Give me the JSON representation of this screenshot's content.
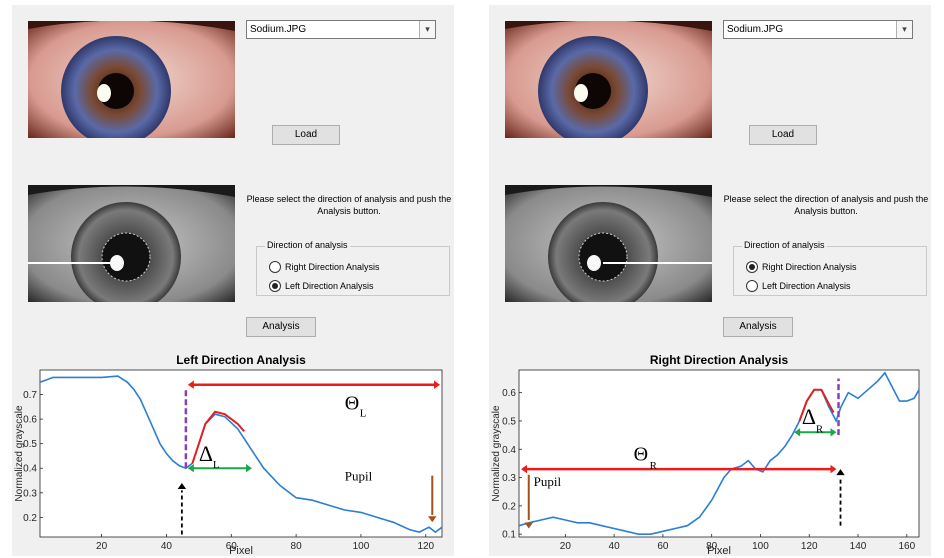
{
  "panels": [
    {
      "file_select": {
        "value": "Sodium.JPG",
        "arrow": "chevron-down-icon"
      },
      "load_button": "Load",
      "instruction": "Please select the direction of analysis and push the Analysis button.",
      "group": {
        "title": "Direction of analysis",
        "options": [
          {
            "label": "Right Direction Analysis",
            "selected": false
          },
          {
            "label": "Left Direction Analysis",
            "selected": true
          }
        ]
      },
      "analysis_button": "Analysis",
      "annotations": {
        "theta": "Θ",
        "theta_sub": "L",
        "delta": "Δ",
        "delta_sub": "L",
        "pupil": "Pupil"
      }
    },
    {
      "file_select": {
        "value": "Sodium.JPG",
        "arrow": "chevron-down-icon"
      },
      "load_button": "Load",
      "instruction": "Please select the direction of analysis and push the Analysis button.",
      "group": {
        "title": "Direction of analysis",
        "options": [
          {
            "label": "Right Direction Analysis",
            "selected": true
          },
          {
            "label": "Left Direction Analysis",
            "selected": false
          }
        ]
      },
      "analysis_button": "Analysis",
      "annotations": {
        "theta": "Θ",
        "theta_sub": "R",
        "delta": "Δ",
        "delta_sub": "R",
        "pupil": "Pupil"
      }
    }
  ],
  "chart_data": [
    {
      "type": "line",
      "title": "Left Direction Analysis",
      "xlabel": "Pixel",
      "ylabel": "Normalized grayscale",
      "xlim": [
        1,
        125
      ],
      "ylim": [
        0.12,
        0.8
      ],
      "xticks": [
        20,
        40,
        60,
        80,
        100,
        120
      ],
      "yticks": [
        0.2,
        0.3,
        0.4,
        0.5,
        0.6,
        0.7
      ],
      "series": [
        {
          "color": "#2a7fd4",
          "x": [
            1,
            5,
            10,
            15,
            20,
            25,
            28,
            30,
            32,
            34,
            36,
            38,
            40,
            42,
            44,
            46,
            48,
            50,
            52,
            55,
            58,
            62,
            66,
            70,
            75,
            80,
            85,
            90,
            95,
            100,
            105,
            110,
            115,
            118,
            121,
            123,
            125
          ],
          "y": [
            0.75,
            0.77,
            0.77,
            0.77,
            0.77,
            0.775,
            0.75,
            0.72,
            0.68,
            0.62,
            0.56,
            0.5,
            0.46,
            0.43,
            0.41,
            0.4,
            0.42,
            0.5,
            0.58,
            0.62,
            0.61,
            0.56,
            0.48,
            0.4,
            0.33,
            0.28,
            0.27,
            0.25,
            0.23,
            0.22,
            0.2,
            0.18,
            0.15,
            0.14,
            0.16,
            0.14,
            0.16
          ]
        },
        {
          "color": "#e02020",
          "x": [
            48,
            50,
            52,
            55,
            58,
            62,
            64
          ],
          "y": [
            0.42,
            0.5,
            0.58,
            0.63,
            0.62,
            0.58,
            0.55
          ]
        }
      ]
    },
    {
      "type": "line",
      "title": "Right Direction Analysis",
      "xlabel": "Pixel",
      "ylabel": "Normalized grayscale",
      "xlim": [
        1,
        165
      ],
      "ylim": [
        0.09,
        0.68
      ],
      "xticks": [
        20,
        40,
        60,
        80,
        100,
        120,
        140,
        160
      ],
      "yticks": [
        0.1,
        0.2,
        0.3,
        0.4,
        0.5,
        0.6
      ],
      "series": [
        {
          "color": "#2a7fd4",
          "x": [
            1,
            5,
            10,
            15,
            20,
            25,
            30,
            35,
            40,
            45,
            50,
            55,
            60,
            65,
            70,
            75,
            80,
            85,
            88,
            92,
            95,
            98,
            101,
            104,
            107,
            110,
            113,
            116,
            119,
            122,
            125,
            128,
            131,
            133,
            136,
            140,
            144,
            148,
            151,
            154,
            157,
            160,
            163,
            165
          ],
          "y": [
            0.13,
            0.14,
            0.15,
            0.16,
            0.15,
            0.14,
            0.14,
            0.13,
            0.12,
            0.11,
            0.1,
            0.1,
            0.11,
            0.12,
            0.13,
            0.16,
            0.22,
            0.3,
            0.33,
            0.34,
            0.36,
            0.33,
            0.32,
            0.36,
            0.38,
            0.41,
            0.45,
            0.5,
            0.57,
            0.61,
            0.61,
            0.55,
            0.5,
            0.55,
            0.6,
            0.58,
            0.61,
            0.64,
            0.67,
            0.62,
            0.57,
            0.57,
            0.58,
            0.61
          ]
        },
        {
          "color": "#e02020",
          "x": [
            116,
            119,
            122,
            125,
            128,
            130
          ],
          "y": [
            0.5,
            0.57,
            0.61,
            0.61,
            0.56,
            0.53
          ]
        }
      ]
    }
  ],
  "markers": [
    {
      "dashed_x": 46,
      "theta_from": 46,
      "theta_to": 125,
      "delta_from": 46,
      "delta_to": 67,
      "pupil_x": 122
    },
    {
      "dashed_x": 132,
      "theta_from": 1,
      "theta_to": 132,
      "delta_from": 113,
      "delta_to": 132,
      "pupil_x": 5
    }
  ]
}
